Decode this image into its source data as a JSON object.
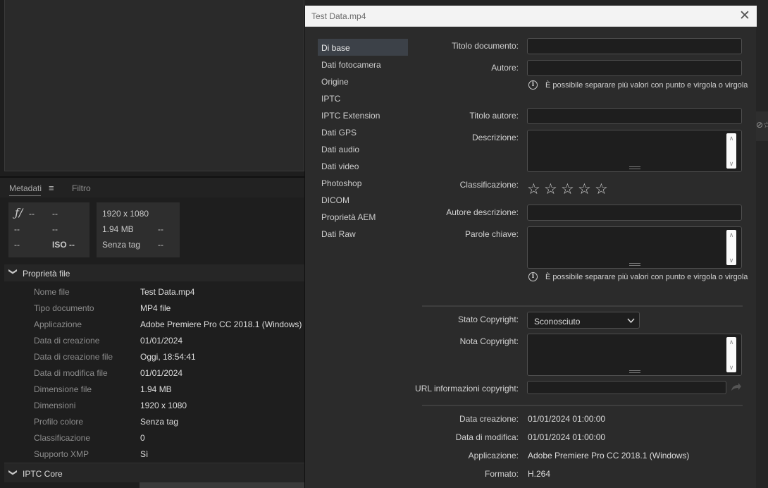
{
  "metadata_panel": {
    "tab_metadata": "Metadati",
    "tab_filter": "Filtro",
    "summary": {
      "f": "ƒ/",
      "r1c2": "--",
      "r1c3": "--",
      "r2c1": "--",
      "r2c3": "--",
      "r3c1": "--",
      "iso": "ISO --",
      "dimensions": "1920 x 1080",
      "size": "1.94 MB",
      "size_extra": "--",
      "color": "Senza tag",
      "color_extra": "--"
    },
    "file_properties_title": "Proprietà file",
    "file_properties": [
      {
        "label": "Nome file",
        "value": "Test Data.mp4"
      },
      {
        "label": "Tipo documento",
        "value": "MP4 file"
      },
      {
        "label": "Applicazione",
        "value": "Adobe Premiere Pro CC 2018.1 (Windows)"
      },
      {
        "label": "Data di creazione",
        "value": "01/01/2024"
      },
      {
        "label": "Data di creazione file",
        "value": "Oggi, 18:54:41"
      },
      {
        "label": "Data di modifica file",
        "value": "01/01/2024"
      },
      {
        "label": "Dimensione file",
        "value": "1.94 MB"
      },
      {
        "label": "Dimensioni",
        "value": "1920 x 1080"
      },
      {
        "label": "Profilo colore",
        "value": "Senza tag"
      },
      {
        "label": "Classificazione",
        "value": "0"
      },
      {
        "label": "Supporto XMP",
        "value": "Sì"
      }
    ],
    "iptc_core_title": "IPTC Core"
  },
  "dialog": {
    "title": "Test Data.mp4",
    "nav": [
      "Di base",
      "Dati fotocamera",
      "Origine",
      "IPTC",
      "IPTC Extension",
      "Dati GPS",
      "Dati audio",
      "Dati video",
      "Photoshop",
      "DICOM",
      "Proprietà AEM",
      "Dati Raw"
    ],
    "fields": {
      "titolo_documento": "Titolo documento:",
      "autore": "Autore:",
      "hint_autore": "È possibile separare più valori con punto e virgola o virgola",
      "titolo_autore": "Titolo autore:",
      "descrizione": "Descrizione:",
      "classificazione": "Classificazione:",
      "autore_descrizione": "Autore descrizione:",
      "parole_chiave": "Parole chiave:",
      "hint_parole": "È possibile separare più valori con punto e virgola o virgola",
      "stato_copyright": "Stato Copyright:",
      "stato_copyright_value": "Sconosciuto",
      "nota_copyright": "Nota Copyright:",
      "url_copyright": "URL informazioni copyright:",
      "data_creazione": "Data creazione:",
      "data_creazione_value": "01/01/2024 01:00:00",
      "data_modifica": "Data di modifica:",
      "data_modifica_value": "01/01/2024 01:00:00",
      "applicazione": "Applicazione:",
      "applicazione_value": "Adobe Premiere Pro CC 2018.1 (Windows)",
      "formato": "Formato:",
      "formato_value": "H.264"
    },
    "rating_stars": 0,
    "rating_max": 5
  },
  "icons": {
    "close": "✕",
    "chevron": "❯",
    "star": "☆",
    "info": "i",
    "menu": "≡"
  }
}
